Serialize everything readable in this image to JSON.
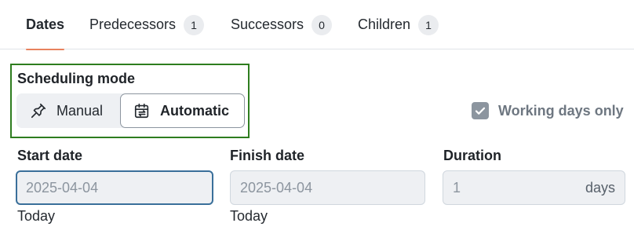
{
  "tabs": [
    {
      "label": "Dates"
    },
    {
      "label": "Predecessors",
      "count": "1"
    },
    {
      "label": "Successors",
      "count": "0"
    },
    {
      "label": "Children",
      "count": "1"
    }
  ],
  "scheduling": {
    "title": "Scheduling mode",
    "manual_label": "Manual",
    "automatic_label": "Automatic",
    "selected": "Automatic"
  },
  "working_days": {
    "label": "Working days only",
    "checked": true
  },
  "fields": {
    "start": {
      "label": "Start date",
      "value": "2025-04-04",
      "hint": "Today"
    },
    "finish": {
      "label": "Finish date",
      "value": "2025-04-04",
      "hint": "Today"
    },
    "duration": {
      "label": "Duration",
      "value": "1",
      "unit": "days"
    }
  },
  "colors": {
    "active_tab_underline": "#e8825e",
    "highlight_border": "#2e7d1f",
    "focus_border": "#3a6f9a"
  }
}
